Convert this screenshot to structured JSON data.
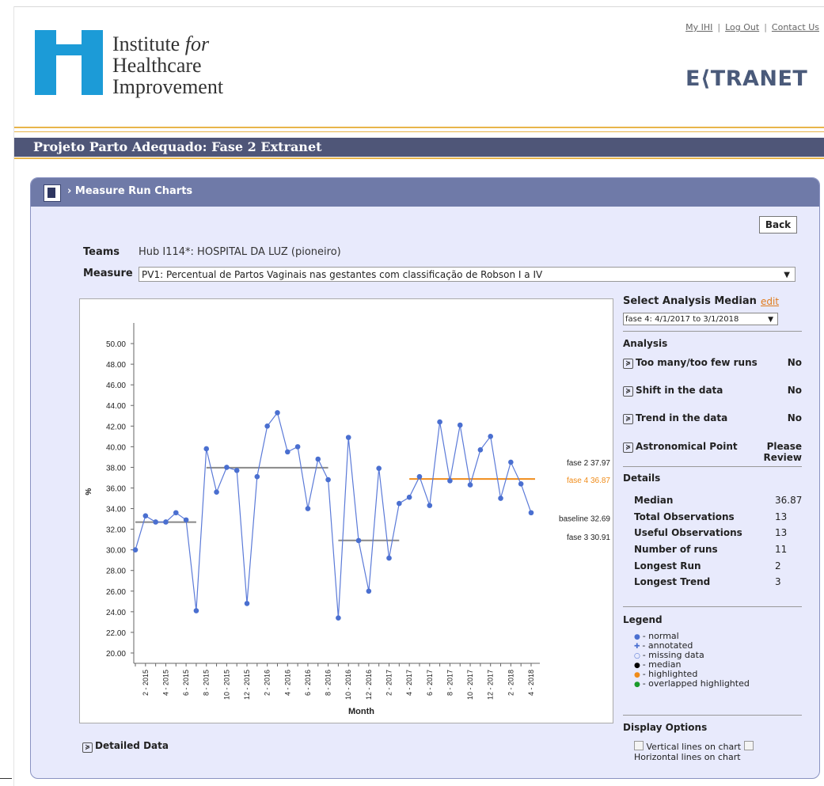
{
  "header": {
    "logo_line1": "Institute",
    "logo_for": "for",
    "logo_line2": "Healthcare",
    "logo_line3": "Improvement",
    "link_my_ihi": "My IHI",
    "link_logout": "Log Out",
    "link_contact": "Contact Us",
    "extranet": "E⟨TRANET",
    "page_title": "Projeto Parto Adequado: Fase 2 Extranet"
  },
  "panel": {
    "title": "Measure Run Charts",
    "back_label": "Back",
    "teams_label": "Teams",
    "teams_value": "Hub I114*: HOSPITAL DA LUZ (pioneiro)",
    "measure_label": "Measure",
    "measure_value": "PV1: Percentual de Partos Vaginais nas gestantes com classificação de Robson I a IV",
    "detailed_data": "Detailed Data"
  },
  "side": {
    "select_median_title": "Select Analysis Median",
    "edit_link": "edit",
    "median_value": "fase 4: 4/1/2017 to 3/1/2018",
    "analysis_title": "Analysis",
    "analysis": [
      {
        "label": "Too many/too few runs",
        "result": "No"
      },
      {
        "label": "Shift in the data",
        "result": "No"
      },
      {
        "label": "Trend in the data",
        "result": "No"
      },
      {
        "label": "Astronomical Point",
        "result": "Please Review"
      }
    ],
    "details_title": "Details",
    "details": [
      {
        "label": "Median",
        "value": "36.87"
      },
      {
        "label": "Total Observations",
        "value": "13"
      },
      {
        "label": "Useful Observations",
        "value": "13"
      },
      {
        "label": "Number of runs",
        "value": "11"
      },
      {
        "label": "Longest Run",
        "value": "2"
      },
      {
        "label": "Longest Trend",
        "value": "3"
      }
    ],
    "legend_title": "Legend",
    "legend": [
      {
        "symbol": "●",
        "color": "#4a6fd0",
        "label": "- normal"
      },
      {
        "symbol": "✚",
        "color": "#4a6fd0",
        "label": "- annotated"
      },
      {
        "symbol": "○",
        "color": "#4a6fd0",
        "label": "- missing data"
      },
      {
        "symbol": "●",
        "color": "#000000",
        "label": "- median"
      },
      {
        "symbol": "●",
        "color": "#f08c1a",
        "label": "- highlighted"
      },
      {
        "symbol": "●",
        "color": "#1a9a2a",
        "label": "- overlapped highlighted"
      }
    ],
    "display_title": "Display Options",
    "opt_vertical": "Vertical lines on chart",
    "opt_horizontal": "Horizontal lines on chart"
  },
  "chart_data": {
    "type": "line",
    "xlabel": "Month",
    "ylabel": "%",
    "ylim": [
      19,
      52
    ],
    "yticks": [
      "20.00",
      "22.00",
      "24.00",
      "26.00",
      "28.00",
      "30.00",
      "32.00",
      "34.00",
      "36.00",
      "38.00",
      "40.00",
      "42.00",
      "44.00",
      "46.00",
      "48.00",
      "50.00"
    ],
    "xticks": [
      "2 - 2015",
      "4 - 2015",
      "6 - 2015",
      "8 - 2015",
      "10 - 2015",
      "12 - 2015",
      "2 - 2016",
      "4 - 2016",
      "6 - 2016",
      "8 - 2016",
      "10 - 2016",
      "12 - 2016",
      "2 - 2017",
      "4 - 2017",
      "6 - 2017",
      "8 - 2017",
      "10 - 2017",
      "12 - 2017",
      "2 - 2018",
      "4 - 2018"
    ],
    "values": [
      30.0,
      33.3,
      32.7,
      32.7,
      33.6,
      32.9,
      24.1,
      39.8,
      35.6,
      38.0,
      37.7,
      24.8,
      37.1,
      42.0,
      43.3,
      39.5,
      40.0,
      34.0,
      38.8,
      36.8,
      23.4,
      40.9,
      30.9,
      26.0,
      37.9,
      29.2,
      34.5,
      35.1,
      37.1,
      34.3,
      42.4,
      36.7,
      42.1,
      36.3,
      39.7,
      41.0,
      35.0,
      38.5,
      36.4,
      33.6
    ],
    "medians": [
      {
        "label": "baseline 32.69",
        "value": 32.69,
        "start": 0,
        "end": 6,
        "color": "#888888",
        "dashed_ext": false
      },
      {
        "label": "fase 2 37.97",
        "value": 37.97,
        "start": 7,
        "end": 19,
        "color": "#888888",
        "dashed_ext": false
      },
      {
        "label": "fase 3 30.91",
        "value": 30.91,
        "start": 20,
        "end": 26,
        "color": "#888888",
        "dashed_ext": false
      },
      {
        "label": "fase 4 36.87",
        "value": 36.87,
        "start": 27,
        "end": 39,
        "color": "#f08c1a",
        "dashed_ext": true
      }
    ],
    "point_color": "#4a6fd0",
    "line_color": "#5b7ad8"
  }
}
